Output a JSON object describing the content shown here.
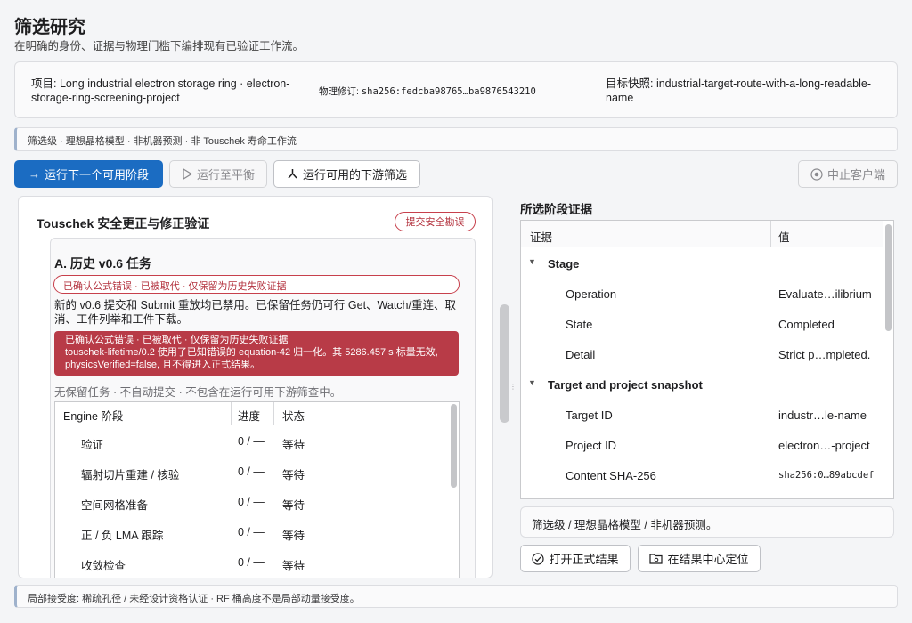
{
  "header": {
    "title": "筛选研究",
    "subtitle": "在明确的身份、证据与物理门槛下编排现有已验证工作流。"
  },
  "info": {
    "project": "项目: Long industrial electron storage ring · electron-storage-ring-screening-project",
    "physics_label": "物理修订: ",
    "physics_hash": "sha256:fedcba98765…ba9876543210",
    "target": "目标快照: industrial-target-route-with-a-long-readable-name"
  },
  "breadcrumb": "筛选级 · 理想晶格模型 · 非机器预测 · 非 Touschek 寿命工作流",
  "toolbar": {
    "run_next_icon": "→",
    "run_next": "运行下一个可用阶段",
    "run_to_eq": "运行至平衡",
    "run_downstream": "运行可用的下游筛选",
    "abort": "中止客户端"
  },
  "left": {
    "title": "Touschek 安全更正与修正验证",
    "submit_btn": "提交安全勘误",
    "task_title": "A. 历史 v0.6 任务",
    "warn_pill": "已确认公式错误 · 已被取代 · 仅保留为历史失败证据",
    "desc": "新的 v0.6 提交和 Submit 重放均已禁用。已保留任务仍可行 Get、Watch/重连、取消、工件列举和工件下载。",
    "error_line1": "已确认公式错误 · 已被取代 · 仅保留为历史失败证据",
    "error_line2": "touschek-lifetime/0.2 使用了已知错误的 equation-42 归一化。其 5286.457 s 标量无效, physicsVerified=false, 且不得进入正式结果。",
    "note": "无保留任务 · 不自动提交 · 不包含在运行可用下游筛查中。",
    "engine_table": {
      "headers": [
        "Engine 阶段",
        "进度",
        "状态"
      ],
      "rows": [
        [
          "验证",
          "0 / —",
          "等待"
        ],
        [
          "辐射切片重建 / 核验",
          "0 / —",
          "等待"
        ],
        [
          "空间网格准备",
          "0 / —",
          "等待"
        ],
        [
          "正 / 负 LMA 跟踪",
          "0 / —",
          "等待"
        ],
        [
          "收敛检查",
          "0 / —",
          "等待"
        ]
      ]
    }
  },
  "right": {
    "title": "所选阶段证据",
    "headers": [
      "证据",
      "值"
    ],
    "rows": [
      {
        "group": true,
        "label": "Stage",
        "value": ""
      },
      {
        "group": false,
        "label": "Operation",
        "value": "Evaluate…ilibrium"
      },
      {
        "group": false,
        "label": "State",
        "value": "Completed"
      },
      {
        "group": false,
        "label": "Detail",
        "value": "Strict p…mpleted."
      },
      {
        "group": true,
        "label": "Target and project snapshot",
        "value": ""
      },
      {
        "group": false,
        "label": "Target ID",
        "value": "industr…le-name"
      },
      {
        "group": false,
        "label": "Project ID",
        "value": "electron…-project"
      },
      {
        "group": false,
        "label": "Content SHA-256",
        "value": "sha256:0…89abcdef"
      }
    ],
    "note": "筛选级 / 理想晶格模型 / 非机器预测。",
    "open_btn": "打开正式结果",
    "locate_btn": "在结果中心定位"
  },
  "footer": "局部接受度: 稀疏孔径 / 未经设计资格认证 · RF 桶高度不是局部动量接受度。"
}
